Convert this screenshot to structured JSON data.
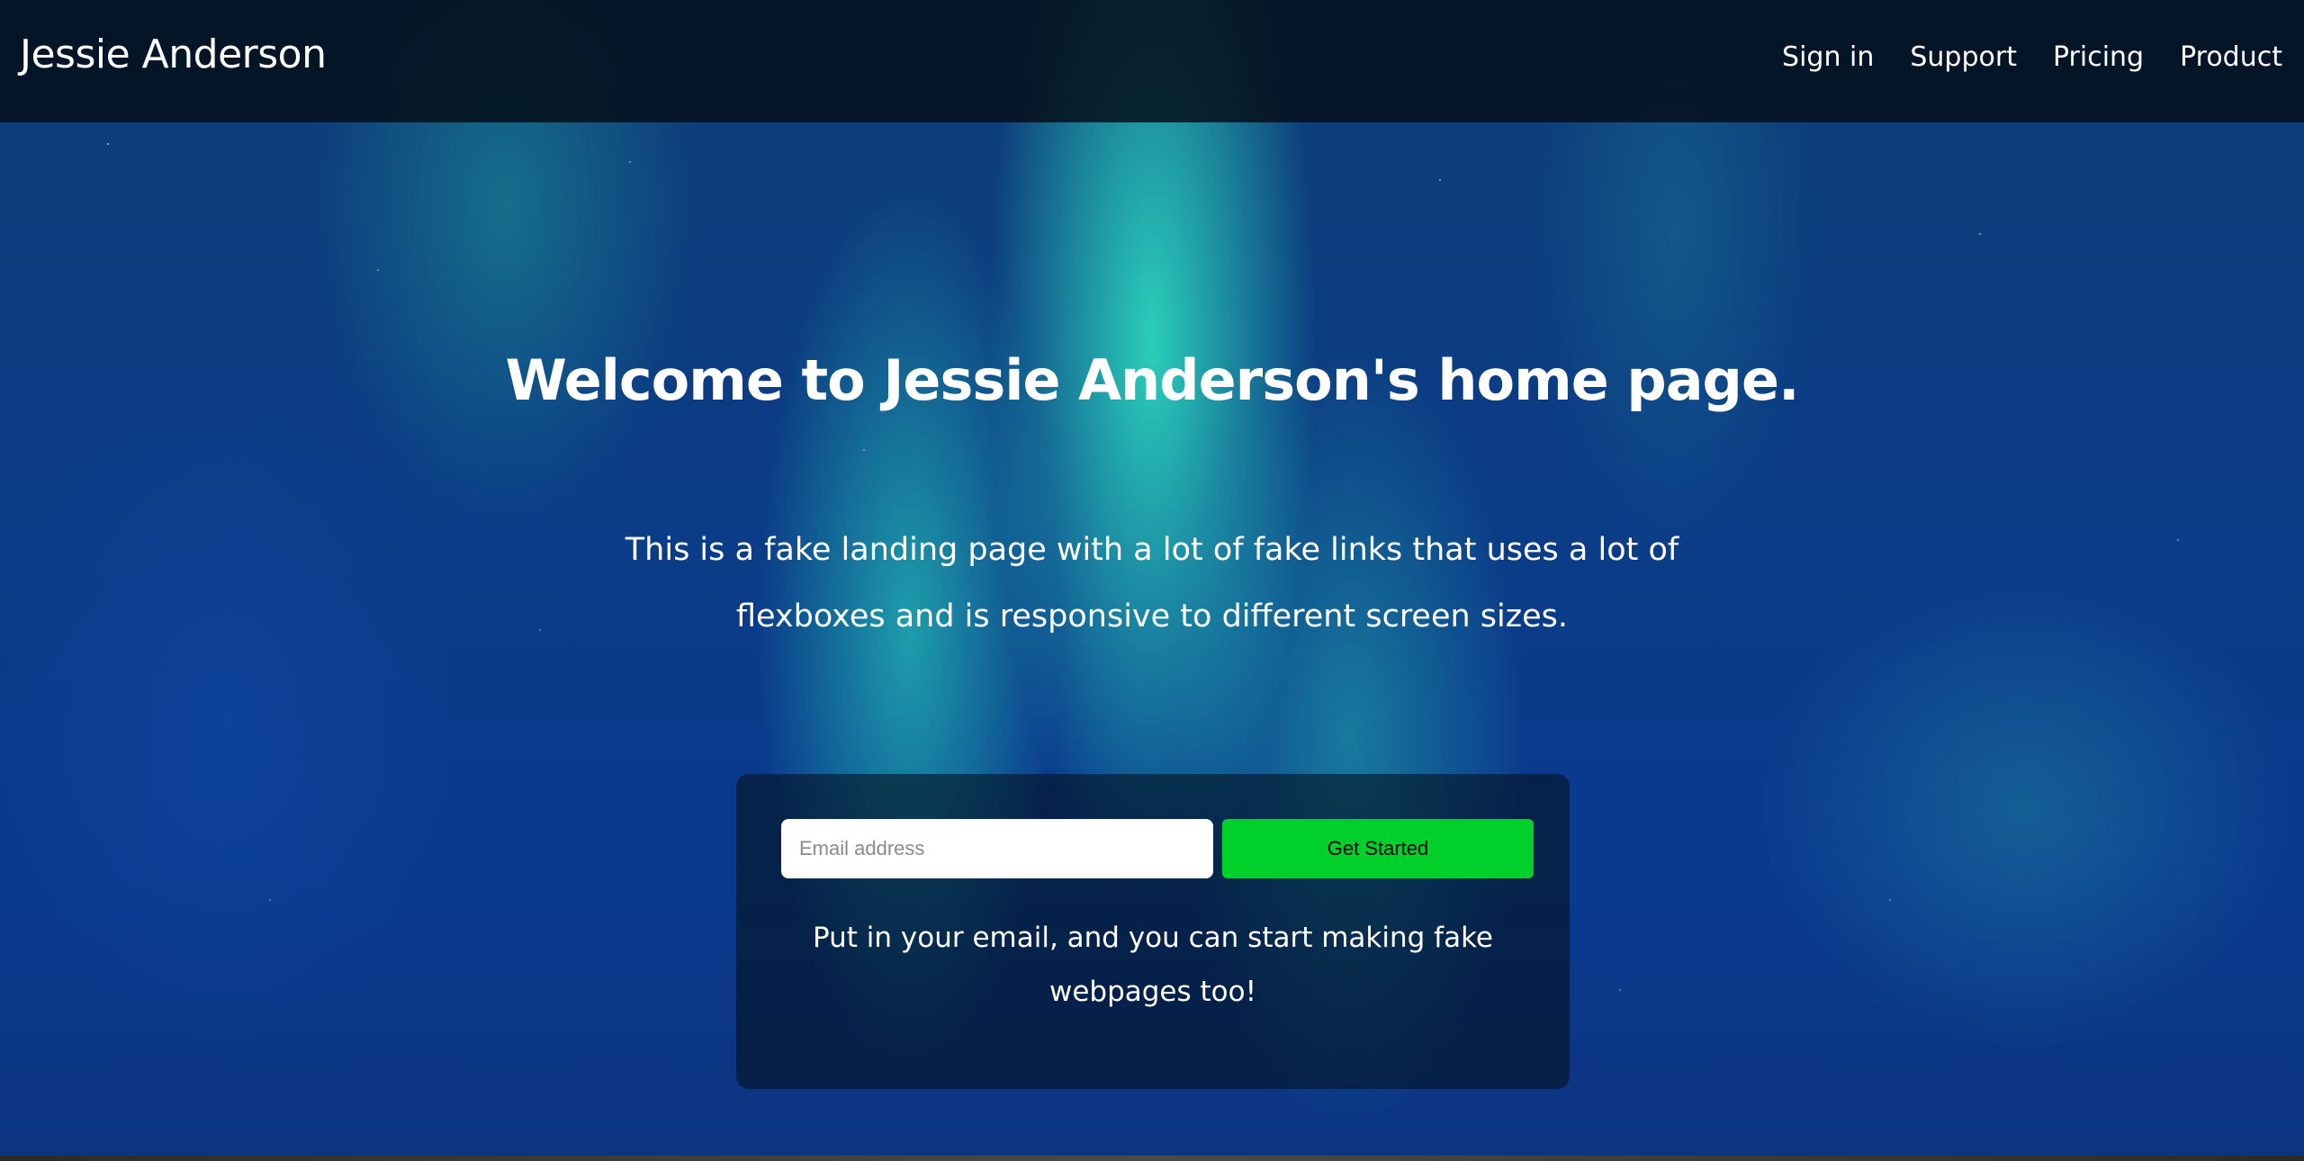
{
  "header": {
    "brand": "Jessie Anderson",
    "nav": [
      {
        "label": "Sign in"
      },
      {
        "label": "Support"
      },
      {
        "label": "Pricing"
      },
      {
        "label": "Product"
      }
    ]
  },
  "hero": {
    "headline": "Welcome to Jessie Anderson's home page.",
    "subtext": "This is a fake landing page with a lot of fake links that uses a lot of flexboxes and is responsive to different screen sizes."
  },
  "signup": {
    "email_placeholder": "Email address",
    "email_value": "",
    "button_label": "Get Started",
    "note": "Put in your email, and you can start making fake webpages too!"
  },
  "colors": {
    "header_bg": "#040c16",
    "button_bg": "#00d12a",
    "text": "#ffffff"
  }
}
